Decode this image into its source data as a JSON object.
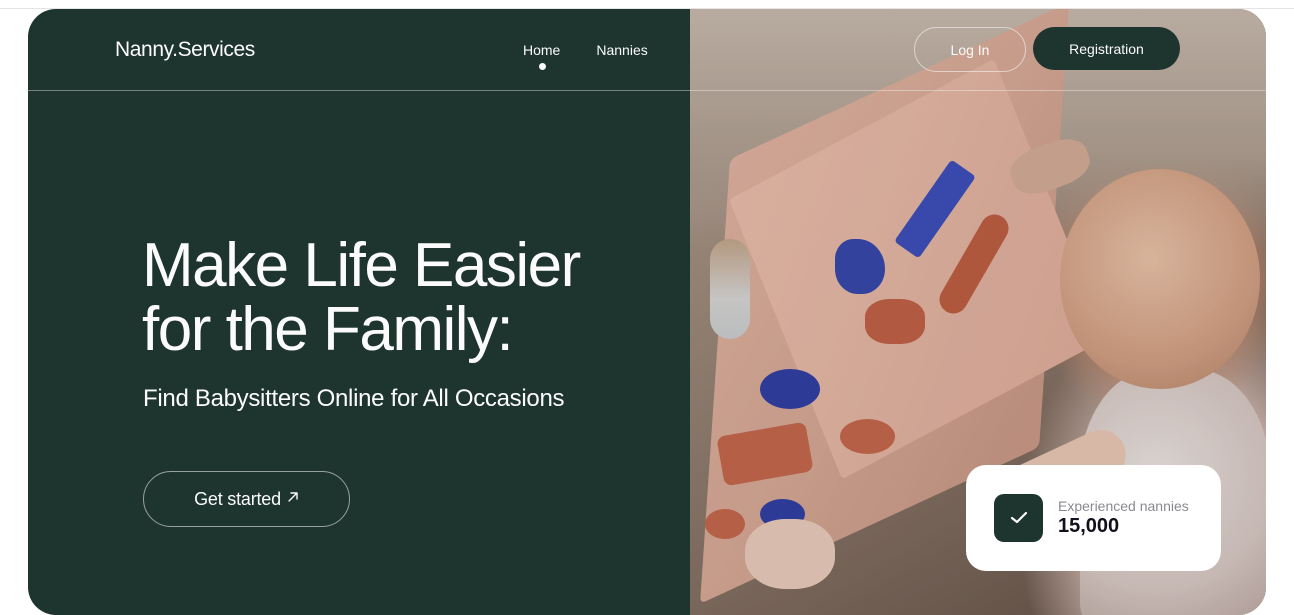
{
  "header": {
    "logo": "Nanny.Services",
    "nav": [
      {
        "label": "Home",
        "active": true
      },
      {
        "label": "Nannies",
        "active": false
      }
    ],
    "login_label": "Log In",
    "register_label": "Registration"
  },
  "hero": {
    "headline_line1": "Make Life Easier",
    "headline_line2": "for the Family:",
    "subheadline": "Find Babysitters Online for All Occasions",
    "cta_label": "Get started"
  },
  "stats": {
    "label": "Experienced nannies",
    "value": "15,000"
  },
  "colors": {
    "primary": "#1e342f",
    "text_light": "#fbfbfb",
    "card_bg": "#ffffff",
    "card_text": "#11101c"
  },
  "icons": [
    "arrow-up-right-icon",
    "check-icon",
    "active-dot-icon"
  ]
}
